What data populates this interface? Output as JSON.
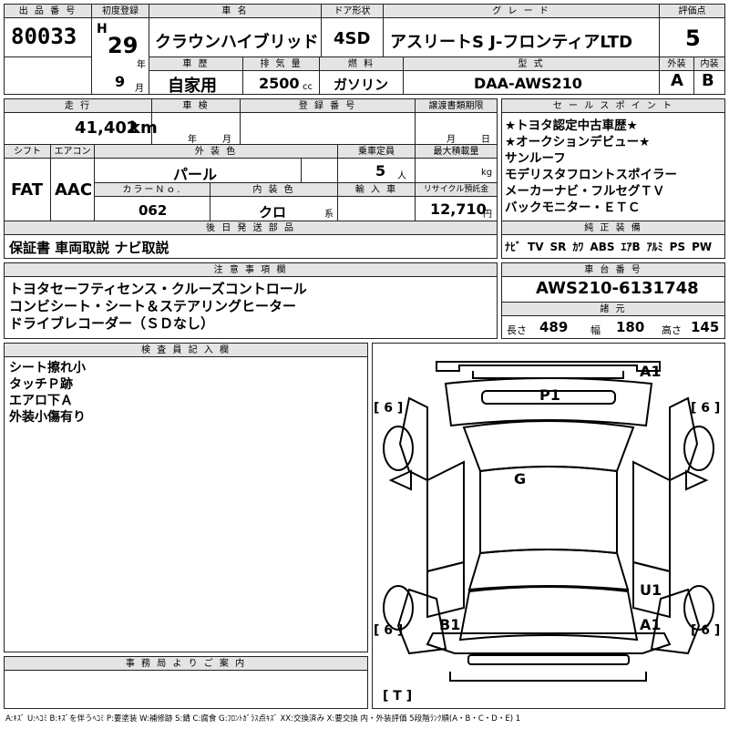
{
  "header": {
    "lot_label": "出 品 番 号",
    "lot": "80033",
    "reg_label": "初度登録",
    "era": "H",
    "year": "29",
    "year_unit": "年",
    "month": "9",
    "month_unit": "月",
    "name_label": "車 名",
    "name": "クラウンハイブリッド",
    "door_label": "ドア形状",
    "door": "4SD",
    "grade_label": "グ レ ー ド",
    "grade": "アスリートS J-フロンティアLTD",
    "score_label": "評価点",
    "score": "5",
    "hist_label": "車 歴",
    "history": "自家用",
    "disp_label": "排 気 量",
    "displacement": "2500",
    "disp_unit": "cc",
    "fuel_label": "燃 料",
    "fuel": "ガソリン",
    "model_label": "型 式",
    "model": "DAA-AWS210",
    "ext_label": "外装",
    "ext": "A",
    "int_label": "内装",
    "int": "B"
  },
  "row2": {
    "km_label": "走 行",
    "mileage": "41,402",
    "km_unit": "km",
    "inspect_label": "車 検",
    "year_unit": "年",
    "month_unit": "月",
    "regno_label": "登 録 番 号",
    "transfer_label": "譲渡書類期限",
    "t_month": "月",
    "t_day": "日"
  },
  "row3": {
    "shift_label": "シフト",
    "shift": "FAT",
    "ac_label": "エアコン",
    "ac": "AAC",
    "color_label": "外 装 色",
    "color": "パール",
    "seats_label": "乗車定員",
    "seats": "5",
    "seats_unit": "人",
    "load_label": "最大積載量",
    "load_unit": "kg",
    "colorno_label": "カラーＮｏ.",
    "color_no": "062",
    "intcolor_label": "内 装 色",
    "int_color": "クロ",
    "int_unit": "系",
    "import_label": "輸 入 車",
    "recycle_label": "リサイクル預託金",
    "recycle": "12,710",
    "recycle_unit": "円"
  },
  "later": {
    "label": "後 日 発 送 部 品",
    "text": "保証書 車両取説 ナビ取説"
  },
  "selling": {
    "label": "セ ー ル ス ポ イ ン ト",
    "items": [
      "★トヨタ認定中古車歴★",
      "★オークションデビュー★",
      "サンルーフ",
      "モデリスタフロントスポイラー",
      "メーカーナビ・フルセグＴＶ",
      "バックモニター・ＥＴＣ"
    ]
  },
  "equip": {
    "label": "純 正 装 備",
    "items": [
      "ﾅﾋﾞ",
      "TV",
      "SR",
      "ｶﾜ",
      "ABS",
      "ｴｱB",
      "ｱﾙﾐ",
      "PS",
      "PW"
    ]
  },
  "notes": {
    "label": "注 意 事 項 欄",
    "lines": [
      "トヨタセーフティセンス・クルーズコントロール",
      "コンビシート・シート＆ステアリングヒーター",
      "ドライブレコーダー（ＳＤなし）"
    ]
  },
  "chassis": {
    "label": "車 台 番 号",
    "number": "AWS210-6131748",
    "spec_label": "諸 元",
    "len_label": "長さ",
    "len": "489",
    "wid_label": "幅",
    "wid": "180",
    "hgt_label": "高さ",
    "hgt": "145"
  },
  "inspector": {
    "label": "検 査 員 記 入 欄",
    "lines": [
      "シート擦れ小",
      "タッチＰ跡",
      "エアロ下Ａ",
      "外装小傷有り"
    ]
  },
  "office": {
    "label": "事 務 局 よ り ご 案 内"
  },
  "diagram": {
    "marks": {
      "a1_top": "A1",
      "p1": "P1",
      "g": "G",
      "u1": "U1",
      "b1": "B1",
      "a1_bottom": "A1"
    },
    "tires": [
      "[ 6 ]",
      "[ 6 ]",
      "[ 6 ]",
      "[ 6 ]"
    ],
    "spare": "[ T ]"
  },
  "footer": "A:ｷｽﾞ U:ﾍｺﾐ B:ｷｽﾞを伴うﾍｺﾐ P:要塗装 W:補修跡 S:錆 C:腐食 G:ﾌﾛﾝﾄｶﾞﾗｽ点ｷｽﾞ XX:交換済み X:要交換 内・外装評価 5段階ﾗﾝｸ順(A・B・C・D・E) 1"
}
